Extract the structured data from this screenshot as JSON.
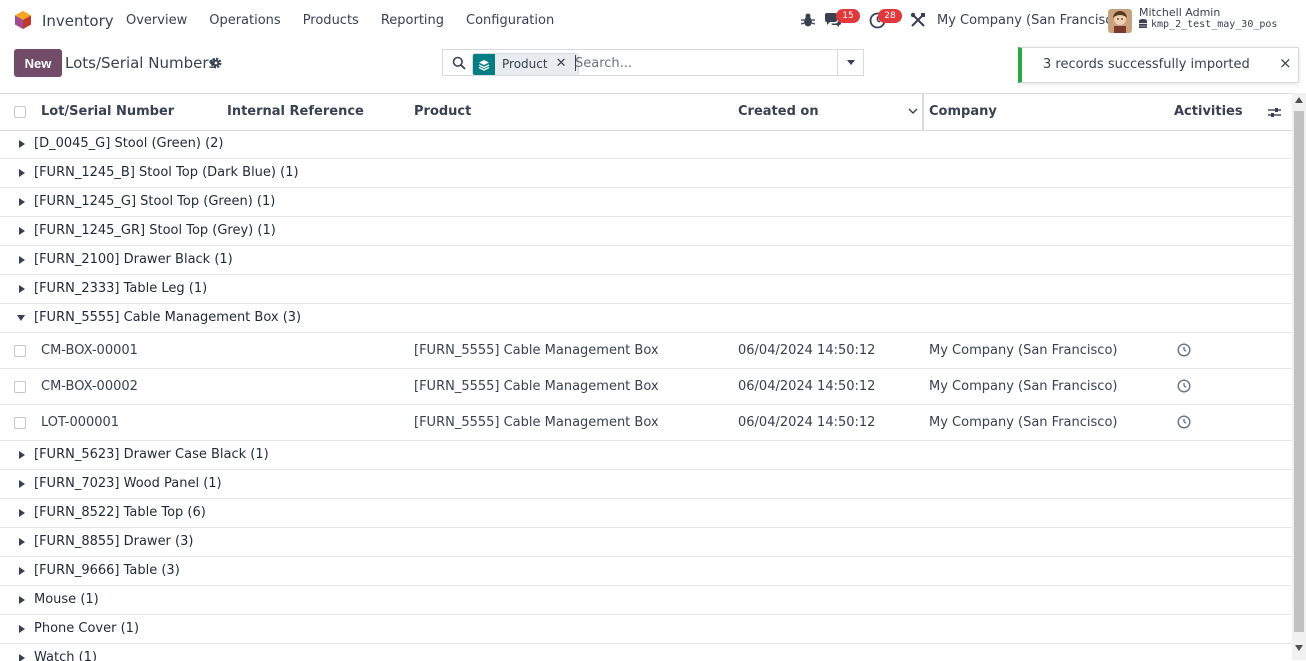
{
  "navbar": {
    "app_name": "Inventory",
    "menu": [
      "Overview",
      "Operations",
      "Products",
      "Reporting",
      "Configuration"
    ],
    "messages_count": "15",
    "activities_count": "28",
    "company": "My Company (San Francisco)",
    "user_name": "Mitchell Admin",
    "database": "kmp_2_test_may_30_pos"
  },
  "control_panel": {
    "new_label": "New",
    "title": "Lots/Serial Numbers",
    "search": {
      "facet_label": "Product",
      "placeholder": "Search..."
    }
  },
  "notification": {
    "message": "3 records successfully imported",
    "close_symbol": "×"
  },
  "table": {
    "columns": {
      "lot": "Lot/Serial Number",
      "ref": "Internal Reference",
      "product": "Product",
      "created": "Created on",
      "company": "Company",
      "activities": "Activities"
    },
    "groups_before": [
      "[D_0045_G] Stool (Green) (2)",
      "[FURN_1245_B] Stool Top (Dark Blue) (1)",
      "[FURN_1245_G] Stool Top (Green) (1)",
      "[FURN_1245_GR] Stool Top (Grey) (1)",
      "[FURN_2100] Drawer Black (1)",
      "[FURN_2333] Table Leg (1)"
    ],
    "open_group": "[FURN_5555] Cable Management Box (3)",
    "records": [
      {
        "lot": "CM-BOX-00001",
        "product": "[FURN_5555] Cable Management Box",
        "created": "06/04/2024 14:50:12",
        "company": "My Company (San Francisco)"
      },
      {
        "lot": "CM-BOX-00002",
        "product": "[FURN_5555] Cable Management Box",
        "created": "06/04/2024 14:50:12",
        "company": "My Company (San Francisco)"
      },
      {
        "lot": "LOT-000001",
        "product": "[FURN_5555] Cable Management Box",
        "created": "06/04/2024 14:50:12",
        "company": "My Company (San Francisco)"
      }
    ],
    "groups_after": [
      "[FURN_5623] Drawer Case Black (1)",
      "[FURN_7023] Wood Panel (1)",
      "[FURN_8522] Table Top (6)",
      "[FURN_8855] Drawer (3)",
      "[FURN_9666] Table (3)",
      "Mouse (1)",
      "Phone Cover (1)",
      "Watch (1)"
    ]
  },
  "colors": {
    "brand": "#714b67",
    "facet": "#017e84",
    "badge": "#e0383b",
    "success": "#28a745"
  }
}
